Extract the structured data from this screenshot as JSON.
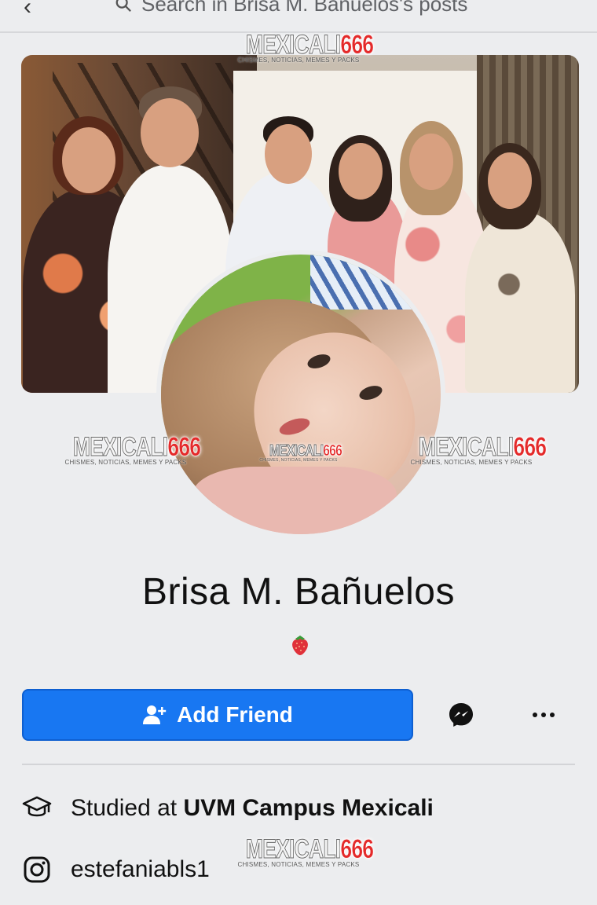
{
  "search": {
    "text": "Search in Brisa M. Bañuelos's posts"
  },
  "watermark": {
    "brand_main": "MEXICALI",
    "brand_number": "666",
    "tagline": "CHISMES, NOTICIAS, MEMES Y PACKS"
  },
  "profile": {
    "name": "Brisa M. Bañuelos",
    "bio_emoji": "strawberry-emoji"
  },
  "actions": {
    "add_friend_label": "Add Friend",
    "messenger": "messenger-icon",
    "more": "more-icon"
  },
  "details": {
    "education_prefix": "Studied at ",
    "education_school": "UVM Campus Mexicali",
    "instagram_handle": "estefaniabls1"
  },
  "colors": {
    "primary": "#1877f2",
    "background": "#ecedef",
    "watermark_red": "#e42a2a"
  }
}
